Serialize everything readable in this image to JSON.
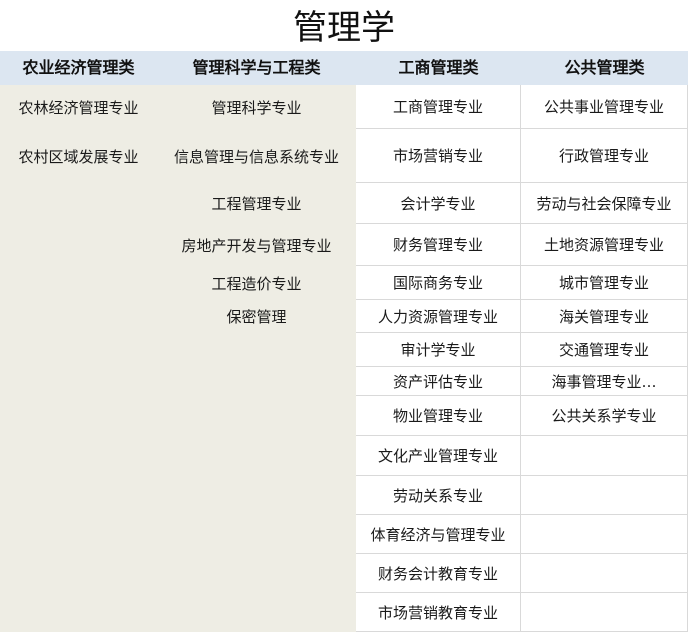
{
  "title": "管理学",
  "headers": [
    "农业经济管理类",
    "管理科学与工程类",
    "工商管理类",
    "公共管理类"
  ],
  "col1": [
    "农林经济管理专业",
    "农村区域发展专业"
  ],
  "col2": [
    "管理科学专业",
    "信息管理与信息系统专业",
    "工程管理专业",
    "房地产开发与管理专业",
    "工程造价专业",
    "保密管理"
  ],
  "col3": [
    "工商管理专业",
    "市场营销专业",
    "会计学专业",
    "财务管理专业",
    "国际商务专业",
    "人力资源管理专业",
    "审计学专业",
    "资产评估专业",
    "物业管理专业",
    "文化产业管理专业",
    "劳动关系专业",
    "体育经济与管理专业",
    "财务会计教育专业",
    "市场营销教育专业"
  ],
  "col4": [
    "公共事业管理专业",
    "行政管理专业",
    "劳动与社会保障专业",
    "土地资源管理专业",
    "城市管理专业",
    "海关管理专业",
    "交通管理专业",
    "海事管理专业…",
    "公共关系学专业"
  ],
  "colors": {
    "header_bg": "#dce6f1",
    "shaded_bg": "#eeede4",
    "grid": "#d9d9d9"
  }
}
